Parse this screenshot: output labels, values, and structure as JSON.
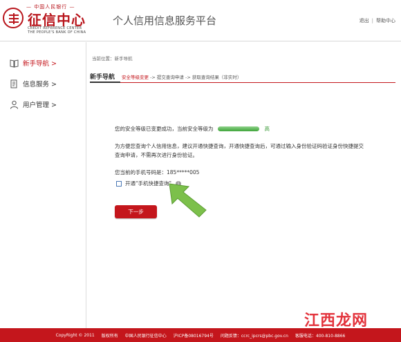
{
  "header": {
    "logo_top": "— 中国人民银行 —",
    "logo_main": "征信中心",
    "logo_en_line1": "CREDIT REFERENCE CENTER",
    "logo_en_line2": "THE PEOPLE'S BANK OF CHINA",
    "platform_title": "个人信用信息服务平台",
    "logout": "退出",
    "help": "帮助中心",
    "separator": "|"
  },
  "sidebar": {
    "items": [
      {
        "label": "新手导航 >",
        "icon": "book-icon",
        "active": true
      },
      {
        "label": "信息服务 >",
        "icon": "document-icon",
        "active": false
      },
      {
        "label": "用户管理 >",
        "icon": "user-icon",
        "active": false
      }
    ]
  },
  "main": {
    "breadcrumb": "当前位置：新手导航",
    "section_title": "新手导航",
    "steps": {
      "current": "安全等级变更",
      "rest": " -> 提交查询申请 -> 获取查询结果（非实时）"
    },
    "security_message": "您的安全等级已变更成功，当前安全等级为",
    "security_level": "高",
    "security_level_fraction": 1.0,
    "description": "为方便您查询个人信用信息，建议开通快捷查询，开通快捷查询后，可通过输入身份验证码验证身份快捷提交查询申请，不需再次进行身份验证。",
    "phone_label": "您当前的手机号码是：185*****005",
    "checkbox_label": "开通\"手机快捷查询\"",
    "checkbox_checked": false,
    "info_icon_glyph": "i",
    "next_button": "下一步"
  },
  "footer": {
    "copyright": "CopyRight © 2011",
    "rights": "版权所有",
    "org": "中国人民银行征信中心",
    "icp": "沪ICP备08016794号",
    "feedback": "问题反馈：ccrc_ipcrs@pbc.gov.cn",
    "hotline": "客服电话：400-810-8866"
  },
  "watermark": "江西龙网",
  "colors": {
    "brand_red": "#c4161c",
    "level_green": "#3fa53a",
    "arrow_green": "#7cc04b"
  }
}
